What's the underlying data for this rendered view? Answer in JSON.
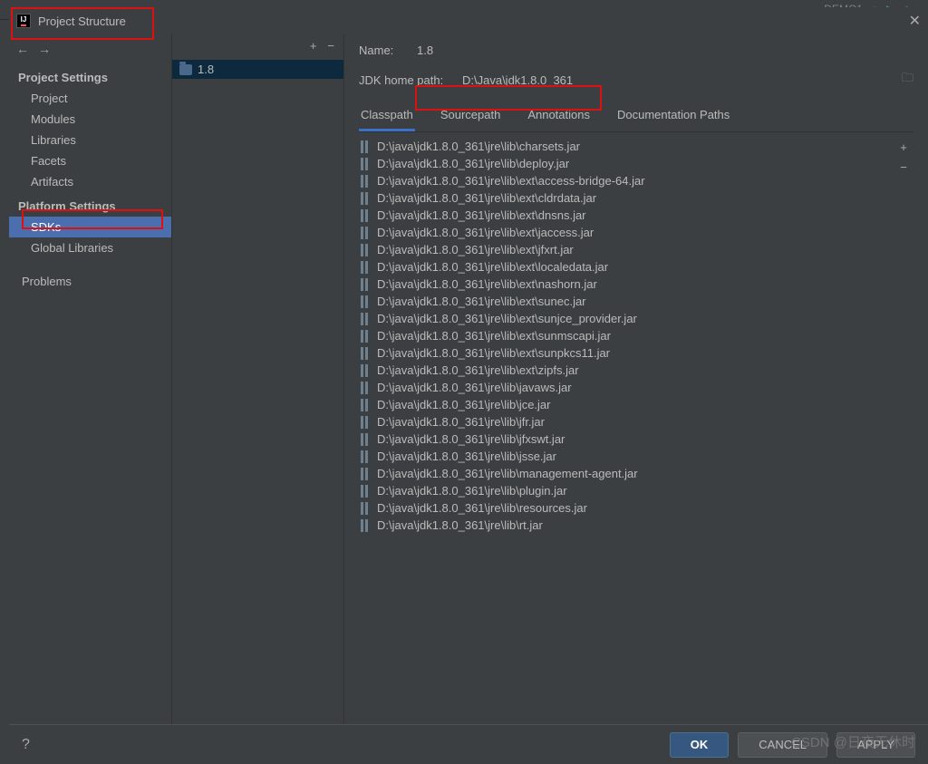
{
  "toolbar": {
    "run_config": "DEMO1"
  },
  "window": {
    "title": "Project Structure"
  },
  "sidebar": {
    "heading_project": "Project Settings",
    "heading_platform": "Platform Settings",
    "items_project": [
      "Project",
      "Modules",
      "Libraries",
      "Facets",
      "Artifacts"
    ],
    "items_platform": [
      "SDKs",
      "Global Libraries"
    ],
    "problems": "Problems"
  },
  "mid": {
    "item_label": "1.8"
  },
  "form": {
    "name_label": "Name:",
    "name_value": "1.8",
    "path_label": "JDK home path:",
    "path_value": "D:\\Java\\jdk1.8.0_361"
  },
  "tabs": [
    "Classpath",
    "Sourcepath",
    "Annotations",
    "Documentation Paths"
  ],
  "classpath": [
    "D:\\java\\jdk1.8.0_361\\jre\\lib\\charsets.jar",
    "D:\\java\\jdk1.8.0_361\\jre\\lib\\deploy.jar",
    "D:\\java\\jdk1.8.0_361\\jre\\lib\\ext\\access-bridge-64.jar",
    "D:\\java\\jdk1.8.0_361\\jre\\lib\\ext\\cldrdata.jar",
    "D:\\java\\jdk1.8.0_361\\jre\\lib\\ext\\dnsns.jar",
    "D:\\java\\jdk1.8.0_361\\jre\\lib\\ext\\jaccess.jar",
    "D:\\java\\jdk1.8.0_361\\jre\\lib\\ext\\jfxrt.jar",
    "D:\\java\\jdk1.8.0_361\\jre\\lib\\ext\\localedata.jar",
    "D:\\java\\jdk1.8.0_361\\jre\\lib\\ext\\nashorn.jar",
    "D:\\java\\jdk1.8.0_361\\jre\\lib\\ext\\sunec.jar",
    "D:\\java\\jdk1.8.0_361\\jre\\lib\\ext\\sunjce_provider.jar",
    "D:\\java\\jdk1.8.0_361\\jre\\lib\\ext\\sunmscapi.jar",
    "D:\\java\\jdk1.8.0_361\\jre\\lib\\ext\\sunpkcs11.jar",
    "D:\\java\\jdk1.8.0_361\\jre\\lib\\ext\\zipfs.jar",
    "D:\\java\\jdk1.8.0_361\\jre\\lib\\javaws.jar",
    "D:\\java\\jdk1.8.0_361\\jre\\lib\\jce.jar",
    "D:\\java\\jdk1.8.0_361\\jre\\lib\\jfr.jar",
    "D:\\java\\jdk1.8.0_361\\jre\\lib\\jfxswt.jar",
    "D:\\java\\jdk1.8.0_361\\jre\\lib\\jsse.jar",
    "D:\\java\\jdk1.8.0_361\\jre\\lib\\management-agent.jar",
    "D:\\java\\jdk1.8.0_361\\jre\\lib\\plugin.jar",
    "D:\\java\\jdk1.8.0_361\\jre\\lib\\resources.jar",
    "D:\\java\\jdk1.8.0_361\\jre\\lib\\rt.jar"
  ],
  "buttons": {
    "ok": "OK",
    "cancel": "CANCEL",
    "apply": "APPLY"
  },
  "watermark": "CSDN @日夜无休时"
}
